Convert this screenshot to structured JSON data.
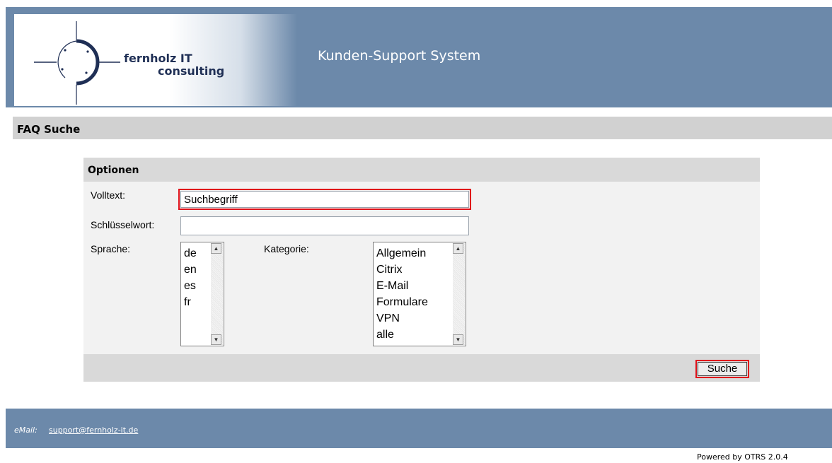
{
  "header": {
    "brand_line1": "fernholz IT",
    "brand_line2": "consulting",
    "app_title": "Kunden-Support System"
  },
  "section": {
    "title": "FAQ Suche"
  },
  "options": {
    "title": "Optionen",
    "fulltext_label": "Volltext:",
    "fulltext_value": "Suchbegriff",
    "keyword_label": "Schlüsselwort:",
    "keyword_value": "",
    "language_label": "Sprache:",
    "languages": [
      "de",
      "en",
      "es",
      "fr"
    ],
    "category_label": "Kategorie:",
    "categories": [
      "Allgemein",
      "Citrix",
      "E-Mail",
      "Formulare",
      "VPN",
      "alle"
    ],
    "search_button": "Suche"
  },
  "footer": {
    "email_label": "eMail:",
    "email": "support@fernholz-it.de",
    "powered_by": "Powered by OTRS 2.0.4"
  },
  "colors": {
    "header_bg": "#6c89aa",
    "highlight": "#e0121b",
    "section_bg": "#d1d1d1"
  }
}
